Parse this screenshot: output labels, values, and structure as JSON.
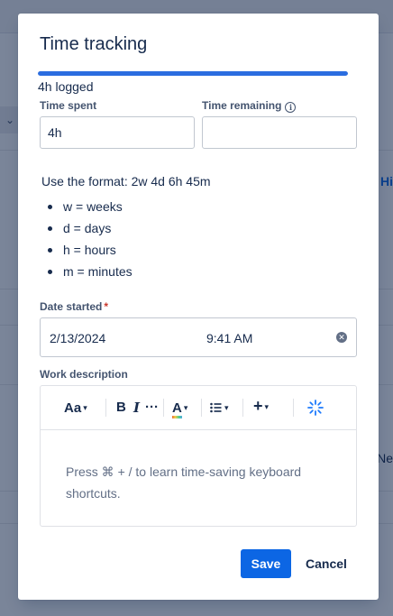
{
  "background": {
    "link_text_1": "Hi",
    "link_text_2": "Ne",
    "collapse_chevron": "⌄"
  },
  "modal": {
    "title": "Time tracking",
    "progress": {
      "fraction": 1.0,
      "summary": "4h logged"
    },
    "time_spent": {
      "label": "Time spent",
      "value": "4h"
    },
    "time_remaining": {
      "label": "Time remaining",
      "value": ""
    },
    "format_help": {
      "intro": "Use the format: 2w 4d 6h 45m",
      "items": [
        "w = weeks",
        "d = days",
        "h = hours",
        "m = minutes"
      ]
    },
    "date_started": {
      "label": "Date started",
      "required_mark": "*",
      "date": "2/13/2024",
      "time": "9:41 AM"
    },
    "work_description": {
      "label": "Work description",
      "toolbar": {
        "text_style": "Aa",
        "bold": "B",
        "italic": "I",
        "more": "···",
        "text_color": "A",
        "add": "+"
      },
      "placeholder": "Press ⌘ + / to learn time-saving keyboard shortcuts."
    },
    "actions": {
      "save": "Save",
      "cancel": "Cancel"
    }
  },
  "colors": {
    "primary": "#0c66e4",
    "progress": "#2b6de0",
    "required": "#c9372c",
    "overlay": "rgba(9,30,66,0.54)"
  }
}
